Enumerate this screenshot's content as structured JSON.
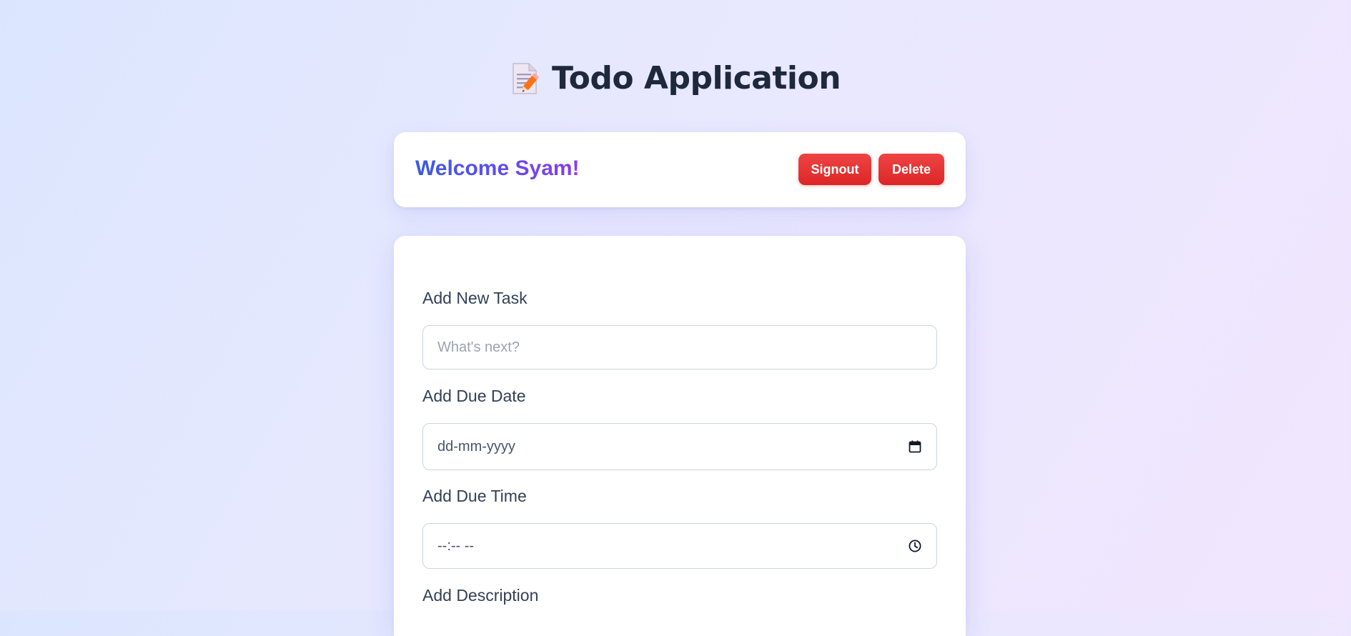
{
  "header": {
    "title": "Todo Application",
    "icon": "memo-icon"
  },
  "welcome": {
    "greeting": "Welcome Syam!",
    "signout_label": "Signout",
    "delete_label": "Delete"
  },
  "form": {
    "task_label": "Add New Task",
    "task_placeholder": "What's next?",
    "date_label": "Add Due Date",
    "date_placeholder": "dd-mm-yyyy",
    "date_icon": "calendar-icon",
    "time_label": "Add Due Time",
    "time_placeholder": "--:-- --",
    "time_icon": "clock-icon",
    "description_label": "Add Description"
  },
  "colors": {
    "danger": "#dc2626",
    "gradient_start": "#3b5bdb",
    "gradient_end": "#8b3be8",
    "title": "#1e293b"
  }
}
